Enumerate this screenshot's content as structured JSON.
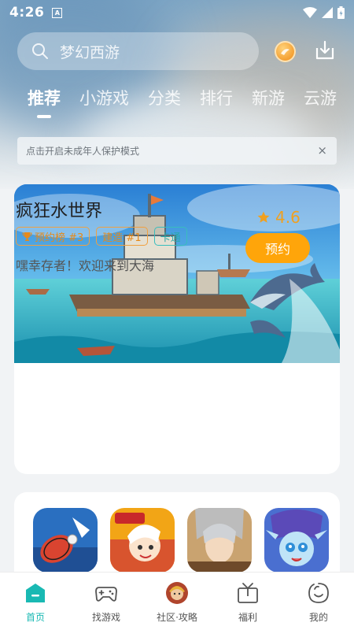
{
  "status_bar": {
    "time": "4:26",
    "notification_icon": "A"
  },
  "search": {
    "placeholder": "梦幻西游"
  },
  "tabs": [
    {
      "label": "推荐",
      "active": true
    },
    {
      "label": "小游戏"
    },
    {
      "label": "分类"
    },
    {
      "label": "排行"
    },
    {
      "label": "新游"
    },
    {
      "label": "云游"
    }
  ],
  "notice": {
    "text": "点击开启未成年人保护模式",
    "close": "×"
  },
  "featured": {
    "title": "疯狂水世界",
    "tags": [
      {
        "label": "预约榜 #3",
        "icon": "trophy-icon",
        "style": "orange"
      },
      {
        "label": "建造 #1",
        "style": "orange"
      },
      {
        "label": "卡通",
        "style": "teal"
      }
    ],
    "description": "嘿幸存者！欢迎来到大海",
    "rating": "4.6",
    "button": "预约"
  },
  "game_icons": [
    {
      "name": "badminton-game"
    },
    {
      "name": "tianwen-game"
    },
    {
      "name": "warrior-game"
    },
    {
      "name": "elf-game"
    }
  ],
  "nav": [
    {
      "label": "首页",
      "icon": "home-icon",
      "active": true
    },
    {
      "label": "找游戏",
      "icon": "gamepad-icon"
    },
    {
      "label": "社区·攻略",
      "icon": "community-avatar-icon"
    },
    {
      "label": "福利",
      "icon": "gift-icon"
    },
    {
      "label": "我的",
      "icon": "profile-icon"
    }
  ],
  "colors": {
    "accent": "#19b9b3",
    "reserve_button": "#ffa50a",
    "rating": "#f0a020"
  }
}
